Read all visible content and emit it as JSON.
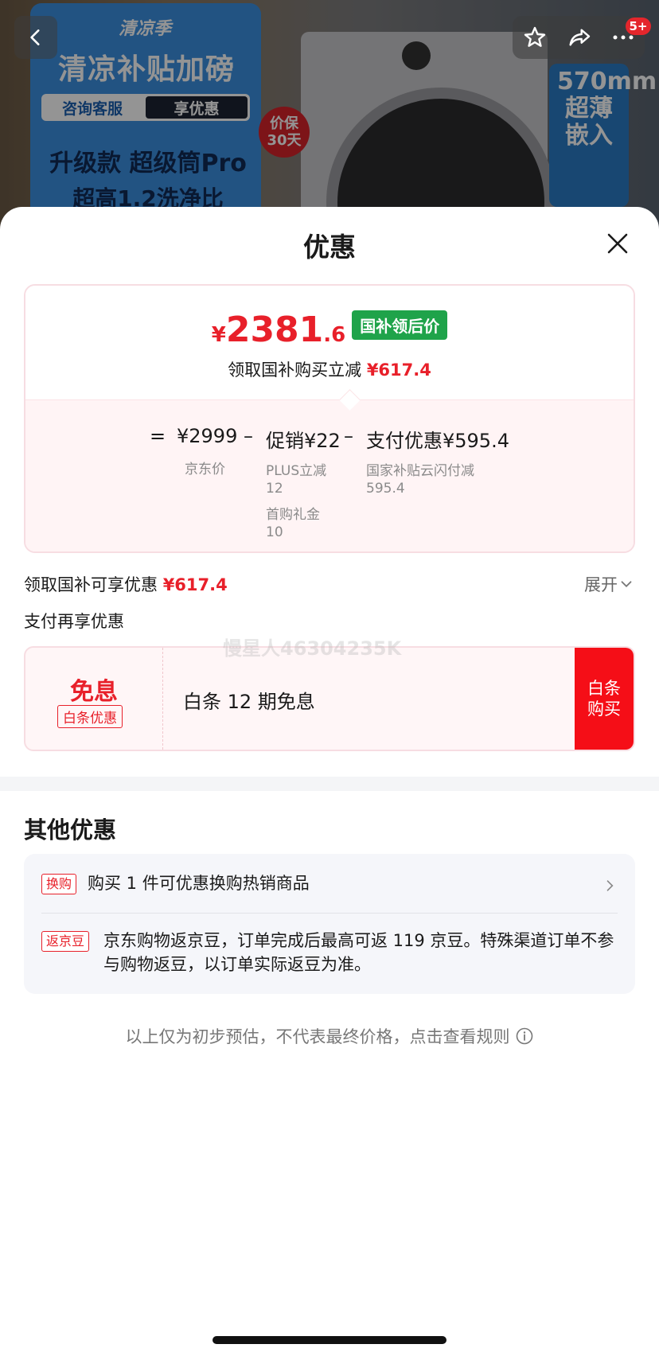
{
  "background": {
    "tagline": "清凉季",
    "title": "清凉补贴加磅",
    "btn_consult": "咨询客服",
    "btn_deal": "享优惠",
    "subtitle1": "升级款 超级筒Pro",
    "subtitle2": "超高1.2洗净比",
    "badge_line1": "价保",
    "badge_line2": "30天",
    "side_text": "570mm超薄嵌入",
    "cart_badge": "5+"
  },
  "sheet": {
    "title": "优惠",
    "price": {
      "currency": "¥",
      "integer": "2381",
      "decimal": ".6",
      "tag": "国补领后价",
      "save_prefix": "领取国补购买立减",
      "save_amount": "¥617.4"
    },
    "formula": {
      "equals": "=",
      "jd_price": "¥2999",
      "jd_price_label": "京东价",
      "minus1": "–",
      "promo": "促销¥22",
      "promo_item1_name": "PLUS立减",
      "promo_item1_value": "12",
      "promo_item2_name": "首购礼金",
      "promo_item2_value": "10",
      "minus2": "–",
      "pay": "支付优惠¥595.4",
      "pay_item_name": "国家补贴云闪付减",
      "pay_item_value": "595.4"
    },
    "subsidy": {
      "label": "领取国补可享优惠",
      "amount": "¥617.4",
      "expand": "展开"
    },
    "pay_section_label": "支付再享优惠",
    "pay_card": {
      "free_label": "免息",
      "tag": "白条优惠",
      "desc": "白条 12 期免息",
      "button": "白条购买"
    },
    "watermark": "慢星人46304235K",
    "other": {
      "title": "其他优惠",
      "items": [
        {
          "tag": "换购",
          "text": "购买 1 件可优惠换购热销商品"
        },
        {
          "tag": "返京豆",
          "text": "京东购物返京豆，订单完成后最高可返 119 京豆。特殊渠道订单不参与购物返豆，以订单实际返豆为准。"
        }
      ]
    },
    "footnote": "以上仅为初步预估，不代表最终价格，点击查看规则"
  },
  "colors": {
    "accent_red": "#e8202a",
    "tag_green": "#1fa34a",
    "button_red": "#f50e17"
  }
}
